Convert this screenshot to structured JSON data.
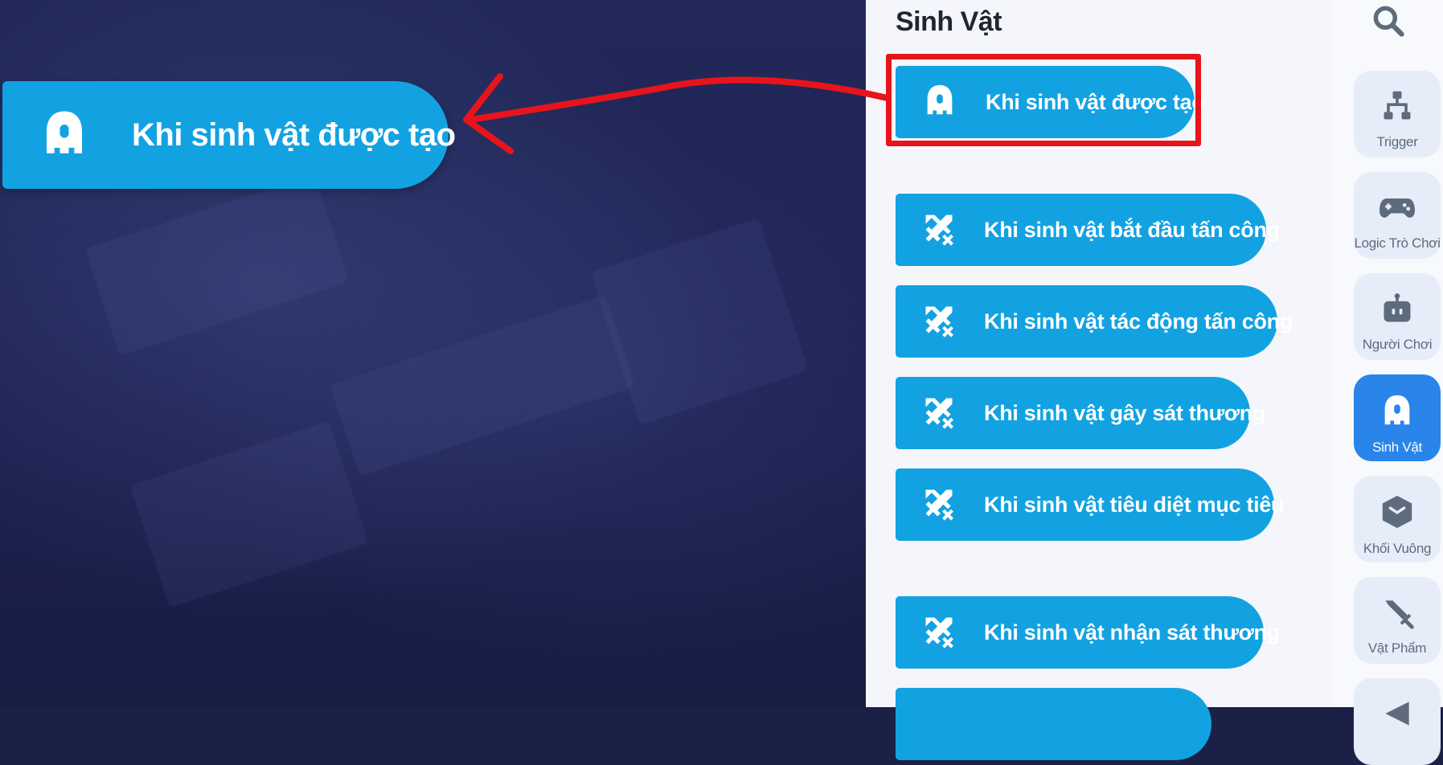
{
  "workspace": {
    "placed_block": {
      "label": "Khi sinh vật được tạo",
      "icon": "creature-icon"
    }
  },
  "palette": {
    "title": "Sinh Vật",
    "blocks": [
      {
        "label": "Khi sinh vật được tạo",
        "icon": "creature-icon",
        "highlighted": true
      },
      {
        "label": "Khi sinh vật bắt đầu tấn công",
        "icon": "crossed-swords-icon"
      },
      {
        "label": "Khi sinh vật tác động tấn công",
        "icon": "crossed-swords-icon"
      },
      {
        "label": "Khi sinh vật gây sát thương",
        "icon": "crossed-swords-icon"
      },
      {
        "label": "Khi sinh vật tiêu diệt mục tiêu",
        "icon": "crossed-swords-icon"
      },
      {
        "label": "Khi sinh vật nhận sát thương",
        "icon": "crossed-swords-icon"
      },
      {
        "label": "",
        "icon": ""
      }
    ]
  },
  "sidebar": {
    "search_icon": "search-icon",
    "categories": [
      {
        "label": "Trigger",
        "icon": "trigger-icon",
        "active": false
      },
      {
        "label": "Logic Trò Chơi",
        "icon": "gamepad-icon",
        "active": false
      },
      {
        "label": "Người Chơi",
        "icon": "robot-icon",
        "active": false
      },
      {
        "label": "Sinh Vật",
        "icon": "creature-icon",
        "active": true
      },
      {
        "label": "Khối Vuông",
        "icon": "cube-icon",
        "active": false
      },
      {
        "label": "Vật Phẩm",
        "icon": "sword-icon",
        "active": false
      },
      {
        "label": "",
        "icon": "flag-icon",
        "active": false
      }
    ]
  },
  "colors": {
    "block_blue": "#12a2e2",
    "highlight_red": "#e8141c",
    "active_category": "#2a85ea",
    "workspace_bg": "#1c2150"
  }
}
